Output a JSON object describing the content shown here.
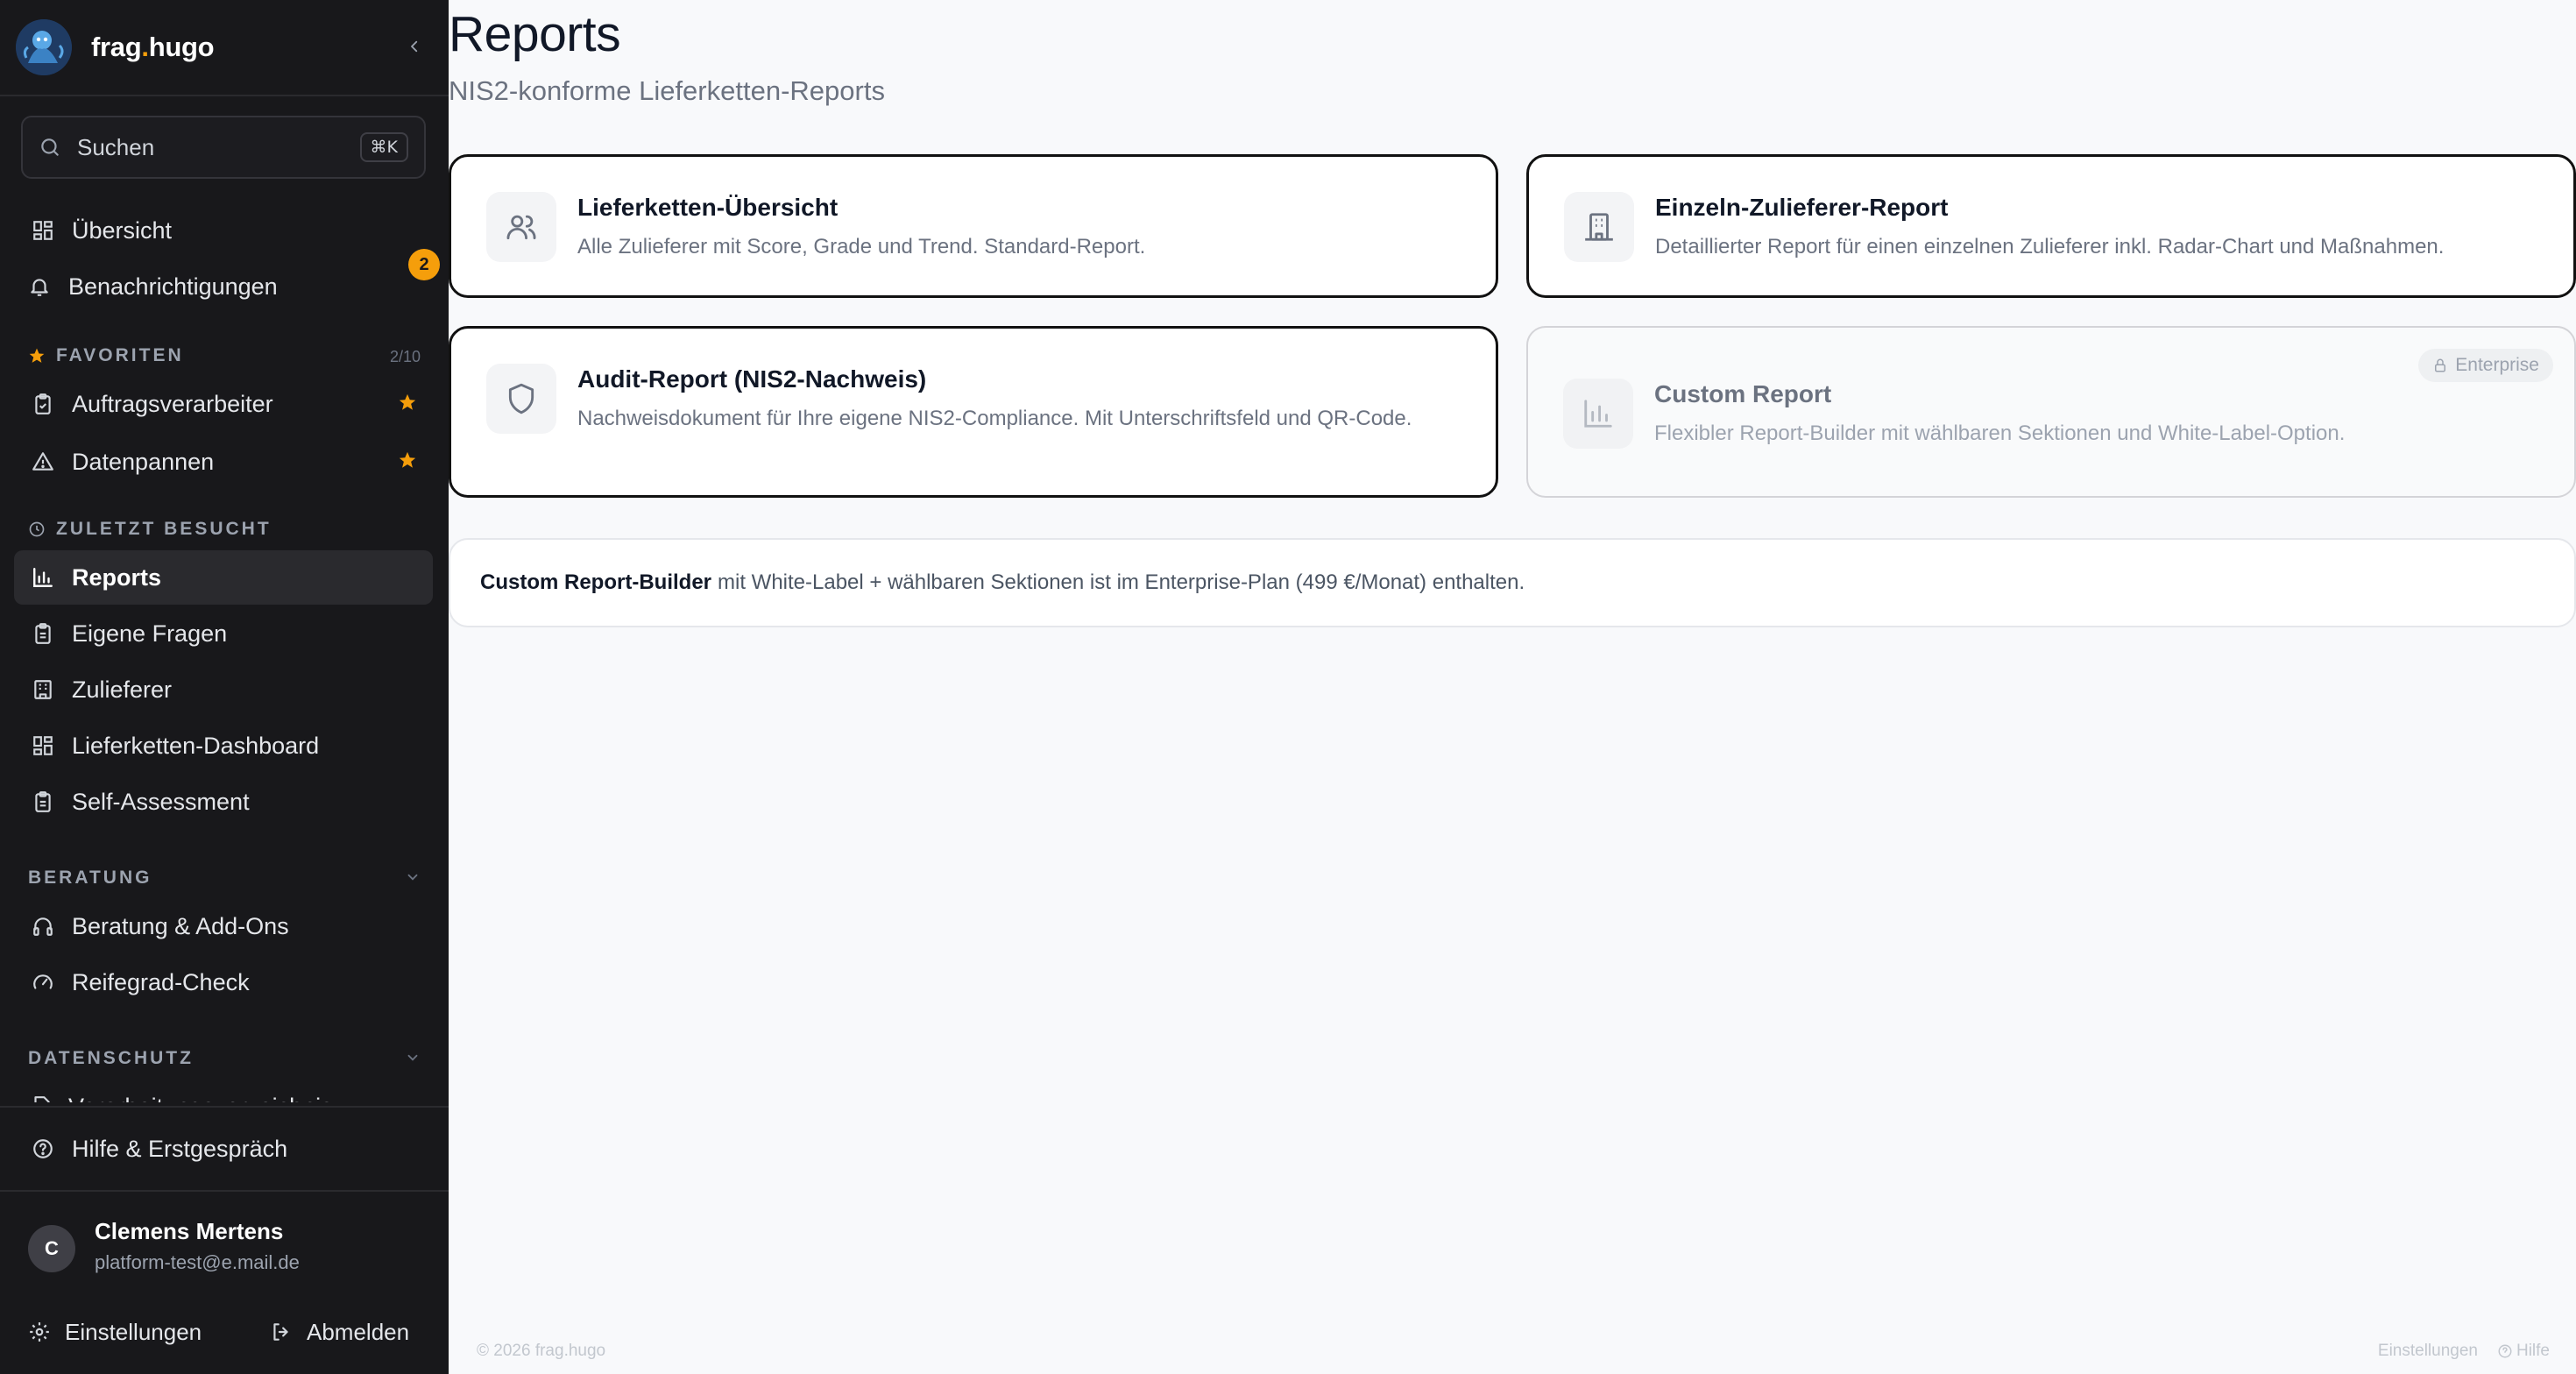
{
  "brand": {
    "name_part1": "frag",
    "name_dot": ".",
    "name_part2": "hugo"
  },
  "search": {
    "label": "Suchen",
    "shortcut": "⌘K"
  },
  "nav": {
    "overview": "Übersicht",
    "notifications": "Benachrichtigungen",
    "notifications_badge": "2"
  },
  "favorites": {
    "label": "FAVORITEN",
    "count": "2/10",
    "items": [
      {
        "label": "Auftragsverarbeiter"
      },
      {
        "label": "Datenpannen"
      }
    ]
  },
  "recent": {
    "label": "ZULETZT BESUCHT",
    "items": [
      {
        "label": "Reports"
      },
      {
        "label": "Eigene Fragen"
      },
      {
        "label": "Zulieferer"
      },
      {
        "label": "Lieferketten-Dashboard"
      },
      {
        "label": "Self-Assessment"
      }
    ]
  },
  "beratung": {
    "label": "BERATUNG",
    "items": [
      {
        "label": "Beratung & Add-Ons"
      },
      {
        "label": "Reifegrad-Check"
      }
    ]
  },
  "datenschutz": {
    "label": "DATENSCHUTZ",
    "items": [
      {
        "label": "Verarbeitungsverzeichnis"
      }
    ]
  },
  "help": {
    "label": "Hilfe & Erstgespräch"
  },
  "user": {
    "initial": "C",
    "name": "Clemens Mertens",
    "email": "platform-test@e.mail.de"
  },
  "bottom": {
    "settings": "Einstellungen",
    "logout": "Abmelden"
  },
  "page": {
    "title": "Reports",
    "subtitle": "NIS2-konforme Lieferketten-Reports"
  },
  "cards": [
    {
      "title": "Lieferketten-Übersicht",
      "desc": "Alle Zulieferer mit Score, Grade und Trend. Standard-Report.",
      "icon": "users-icon"
    },
    {
      "title": "Einzeln-Zulieferer-Report",
      "desc": "Detaillierter Report für einen einzelnen Zulieferer inkl. Radar-Chart und Maßnahmen.",
      "icon": "building-icon"
    },
    {
      "title": "Audit-Report (NIS2-Nachweis)",
      "desc": "Nachweisdokument für Ihre eigene NIS2-Compliance. Mit Unterschriftsfeld und QR-Code.",
      "icon": "shield-icon"
    },
    {
      "title": "Custom Report",
      "desc": "Flexibler Report-Builder mit wählbaren Sektionen und White-Label-Option.",
      "icon": "bar-chart-icon",
      "badge": "Enterprise"
    }
  ],
  "info": {
    "bold": "Custom Report-Builder",
    "text": "mit White-Label + wählbaren Sektionen ist im Enterprise-Plan (499 €/Monat) enthalten."
  },
  "footer": {
    "copyright": "© 2026 frag.hugo",
    "settings": "Einstellungen",
    "help": "Hilfe"
  },
  "colors": {
    "sidebar_bg": "#18181b",
    "accent": "#f59e0b",
    "main_bg": "#f8f9fb"
  }
}
